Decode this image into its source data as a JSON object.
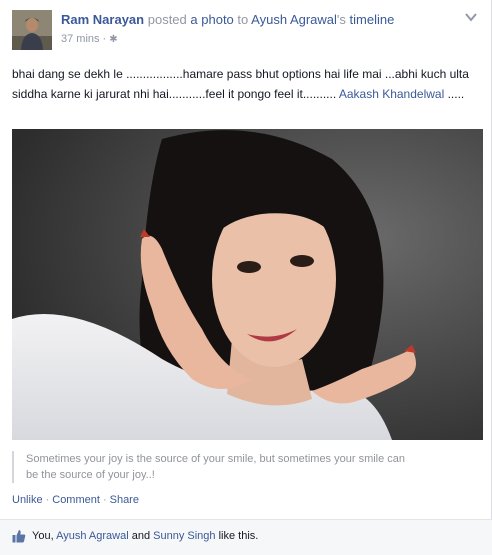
{
  "post": {
    "author": "Ram Narayan",
    "action_text": "posted",
    "object_link": "a photo",
    "connector": "to",
    "target_name": "Ayush Agrawal",
    "target_suffix": "'s",
    "target_page": "timeline",
    "time": "37 mins",
    "separator": "·",
    "audience_icon": "gear-icon",
    "menu_icon": "chevron-down-icon",
    "message_text": "bhai dang se dekh le .................hamare pass bhut options hai life mai ...abhi kuch ulta siddha karne ki jarurat nhi hai...........feel it pongo feel it..........",
    "message_tag": "Aakash Khandelwal",
    "message_tail": " .....",
    "caption": "Sometimes your joy is the source of your smile, but sometimes your smile can be the source of your joy..!",
    "actions": {
      "unlike": "Unlike",
      "comment": "Comment",
      "share": "Share",
      "dot": "·"
    },
    "likes": {
      "icon": "thumbs-up-icon",
      "you": "You,",
      "person1": "Ayush Agrawal",
      "and": "and",
      "person2": "Sunny Singh",
      "suffix": "like this."
    }
  },
  "colors": {
    "link": "#3b5998",
    "meta": "#9197a3",
    "text": "#141823",
    "likes_bg": "#f6f7f8"
  }
}
